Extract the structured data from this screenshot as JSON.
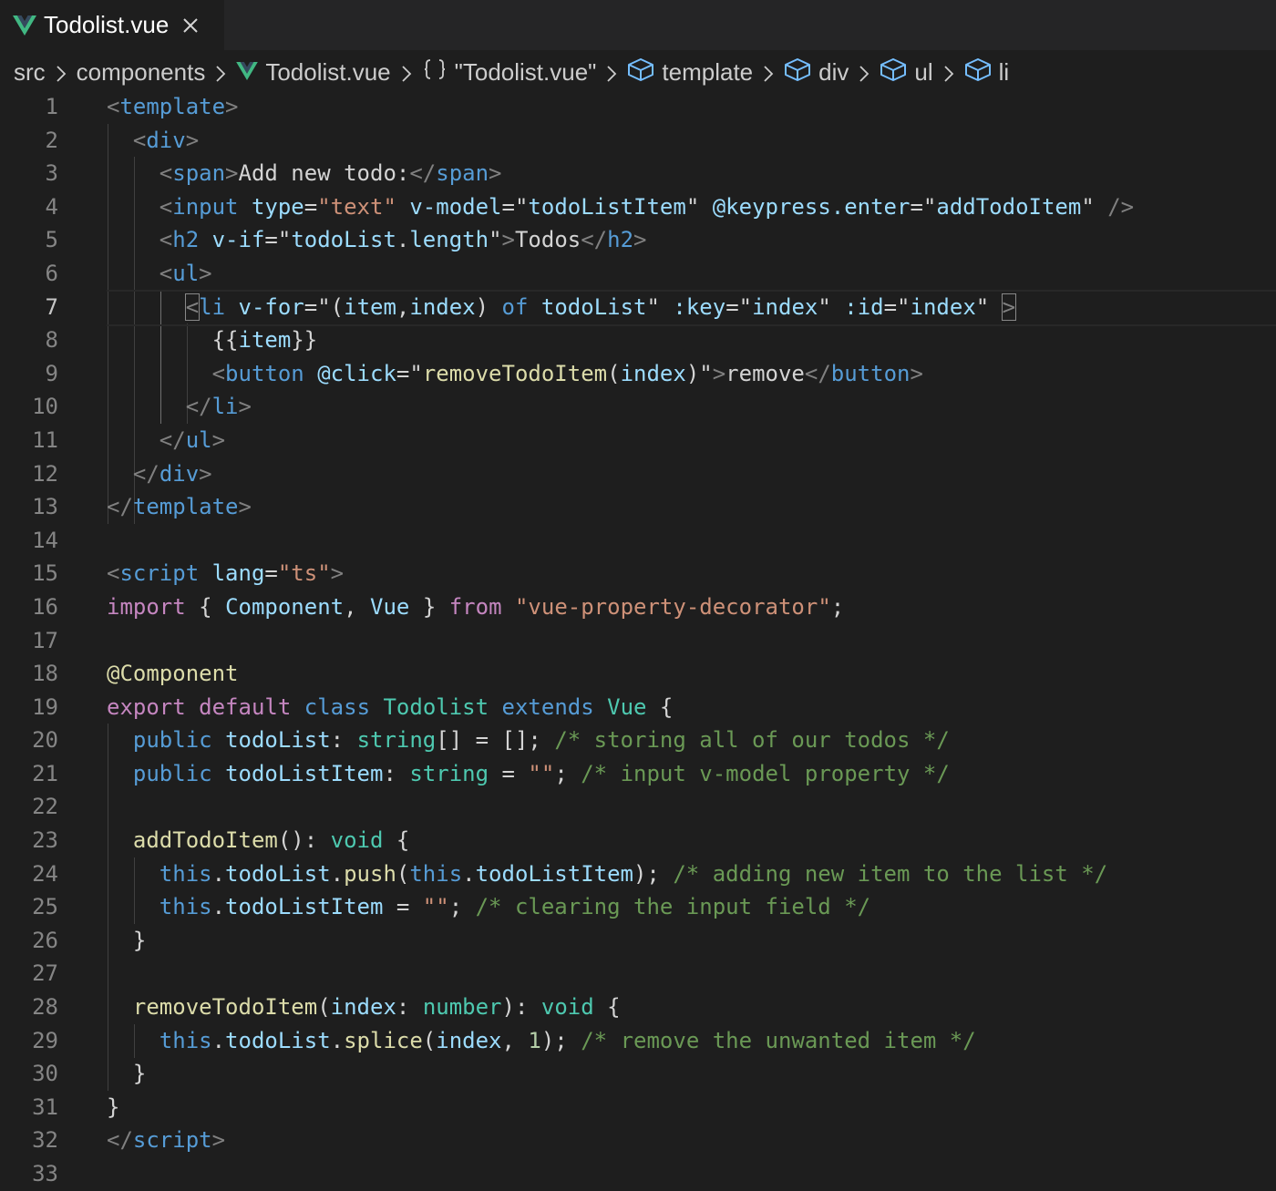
{
  "tab": {
    "title": "Todolist.vue",
    "icon": "vue-logo-icon",
    "close_icon": "close-icon"
  },
  "breadcrumb": [
    "src",
    "components",
    "Todolist.vue",
    "\"Todolist.vue\"",
    "template",
    "div",
    "ul",
    "li"
  ],
  "breadcrumb_icons": {
    "file": "vue-logo-icon",
    "root": "braces-icon",
    "element": "symbol-cube-icon"
  },
  "editor": {
    "current_line": 7,
    "line_numbers": [
      "1",
      "2",
      "3",
      "4",
      "5",
      "6",
      "7",
      "8",
      "9",
      "10",
      "11",
      "12",
      "13",
      "14",
      "15",
      "16",
      "17",
      "18",
      "19",
      "20",
      "21",
      "22",
      "23",
      "24",
      "25",
      "26",
      "27",
      "28",
      "29",
      "30",
      "31",
      "32",
      "33"
    ],
    "lines": [
      [
        [
          "tg",
          "<"
        ],
        [
          "tn",
          "template"
        ],
        [
          "tg",
          ">"
        ]
      ],
      [
        [
          "txt",
          "  "
        ],
        [
          "tg",
          "<"
        ],
        [
          "tn",
          "div"
        ],
        [
          "tg",
          ">"
        ]
      ],
      [
        [
          "txt",
          "    "
        ],
        [
          "tg",
          "<"
        ],
        [
          "tn",
          "span"
        ],
        [
          "tg",
          ">"
        ],
        [
          "txt",
          "Add new todo:"
        ],
        [
          "tg",
          "</"
        ],
        [
          "tn",
          "span"
        ],
        [
          "tg",
          ">"
        ]
      ],
      [
        [
          "txt",
          "    "
        ],
        [
          "tg",
          "<"
        ],
        [
          "tn",
          "input"
        ],
        [
          "txt",
          " "
        ],
        [
          "at",
          "type"
        ],
        [
          "txt",
          "="
        ],
        [
          "str",
          "\"text\""
        ],
        [
          "txt",
          " "
        ],
        [
          "at",
          "v-model"
        ],
        [
          "txt",
          "=\""
        ],
        [
          "var",
          "todoListItem"
        ],
        [
          "txt",
          "\" "
        ],
        [
          "at",
          "@keypress.enter"
        ],
        [
          "txt",
          "=\""
        ],
        [
          "var",
          "addTodoItem"
        ],
        [
          "txt",
          "\" "
        ],
        [
          "tg",
          "/>"
        ]
      ],
      [
        [
          "txt",
          "    "
        ],
        [
          "tg",
          "<"
        ],
        [
          "tn",
          "h2"
        ],
        [
          "txt",
          " "
        ],
        [
          "at",
          "v-if"
        ],
        [
          "txt",
          "=\""
        ],
        [
          "var",
          "todoList"
        ],
        [
          "txt",
          "."
        ],
        [
          "var",
          "length"
        ],
        [
          "txt",
          "\""
        ],
        [
          "tg",
          ">"
        ],
        [
          "txt",
          "Todos"
        ],
        [
          "tg",
          "</"
        ],
        [
          "tn",
          "h2"
        ],
        [
          "tg",
          ">"
        ]
      ],
      [
        [
          "txt",
          "    "
        ],
        [
          "tg",
          "<"
        ],
        [
          "tn",
          "ul"
        ],
        [
          "tg",
          ">"
        ]
      ],
      [
        [
          "txt",
          "      "
        ],
        [
          "tg",
          "<",
          "box"
        ],
        [
          "tn",
          "li"
        ],
        [
          "txt",
          " "
        ],
        [
          "at",
          "v-for"
        ],
        [
          "txt",
          "=\"("
        ],
        [
          "var",
          "item"
        ],
        [
          "txt",
          ","
        ],
        [
          "var",
          "index"
        ],
        [
          "txt",
          ") "
        ],
        [
          "kw2",
          "of"
        ],
        [
          "txt",
          " "
        ],
        [
          "var",
          "todoList"
        ],
        [
          "txt",
          "\" "
        ],
        [
          "at",
          ":key"
        ],
        [
          "txt",
          "=\""
        ],
        [
          "var",
          "index"
        ],
        [
          "txt",
          "\" "
        ],
        [
          "at",
          ":id"
        ],
        [
          "txt",
          "=\""
        ],
        [
          "var",
          "index"
        ],
        [
          "txt",
          "\" "
        ],
        [
          "tg",
          ">",
          "box"
        ]
      ],
      [
        [
          "txt",
          "        {{"
        ],
        [
          "var",
          "item"
        ],
        [
          "txt",
          "}}"
        ]
      ],
      [
        [
          "txt",
          "        "
        ],
        [
          "tg",
          "<"
        ],
        [
          "tn",
          "button"
        ],
        [
          "txt",
          " "
        ],
        [
          "at",
          "@click"
        ],
        [
          "txt",
          "=\""
        ],
        [
          "fn",
          "removeTodoItem"
        ],
        [
          "txt",
          "("
        ],
        [
          "var",
          "index"
        ],
        [
          "txt",
          ")\""
        ],
        [
          "tg",
          ">"
        ],
        [
          "txt",
          "remove"
        ],
        [
          "tg",
          "</"
        ],
        [
          "tn",
          "button"
        ],
        [
          "tg",
          ">"
        ]
      ],
      [
        [
          "txt",
          "      "
        ],
        [
          "tg",
          "</"
        ],
        [
          "tn",
          "li"
        ],
        [
          "tg",
          ">"
        ]
      ],
      [
        [
          "txt",
          "    "
        ],
        [
          "tg",
          "</"
        ],
        [
          "tn",
          "ul"
        ],
        [
          "tg",
          ">"
        ]
      ],
      [
        [
          "txt",
          "  "
        ],
        [
          "tg",
          "</"
        ],
        [
          "tn",
          "div"
        ],
        [
          "tg",
          ">"
        ]
      ],
      [
        [
          "tg",
          "</"
        ],
        [
          "tn",
          "template"
        ],
        [
          "tg",
          ">"
        ]
      ],
      [],
      [
        [
          "tg",
          "<"
        ],
        [
          "tn",
          "script"
        ],
        [
          "txt",
          " "
        ],
        [
          "at",
          "lang"
        ],
        [
          "txt",
          "="
        ],
        [
          "str",
          "\"ts\""
        ],
        [
          "tg",
          ">"
        ]
      ],
      [
        [
          "kw",
          "import"
        ],
        [
          "txt",
          " { "
        ],
        [
          "var",
          "Component"
        ],
        [
          "txt",
          ", "
        ],
        [
          "var",
          "Vue"
        ],
        [
          "txt",
          " } "
        ],
        [
          "kw",
          "from"
        ],
        [
          "txt",
          " "
        ],
        [
          "str",
          "\"vue-property-decorator\""
        ],
        [
          "txt",
          ";"
        ]
      ],
      [],
      [
        [
          "dec",
          "@"
        ],
        [
          "fn",
          "Component"
        ]
      ],
      [
        [
          "kw",
          "export"
        ],
        [
          "txt",
          " "
        ],
        [
          "kw",
          "default"
        ],
        [
          "txt",
          " "
        ],
        [
          "kw2",
          "class"
        ],
        [
          "txt",
          " "
        ],
        [
          "cls",
          "Todolist"
        ],
        [
          "txt",
          " "
        ],
        [
          "kw2",
          "extends"
        ],
        [
          "txt",
          " "
        ],
        [
          "cls",
          "Vue"
        ],
        [
          "txt",
          " {"
        ]
      ],
      [
        [
          "txt",
          "  "
        ],
        [
          "kw2",
          "public"
        ],
        [
          "txt",
          " "
        ],
        [
          "var",
          "todoList"
        ],
        [
          "txt",
          ": "
        ],
        [
          "cls",
          "string"
        ],
        [
          "txt",
          "[] = []; "
        ],
        [
          "cm",
          "/* storing all of our todos */"
        ]
      ],
      [
        [
          "txt",
          "  "
        ],
        [
          "kw2",
          "public"
        ],
        [
          "txt",
          " "
        ],
        [
          "var",
          "todoListItem"
        ],
        [
          "txt",
          ": "
        ],
        [
          "cls",
          "string"
        ],
        [
          "txt",
          " = "
        ],
        [
          "str",
          "\"\""
        ],
        [
          "txt",
          "; "
        ],
        [
          "cm",
          "/* input v-model property */"
        ]
      ],
      [],
      [
        [
          "txt",
          "  "
        ],
        [
          "fn",
          "addTodoItem"
        ],
        [
          "txt",
          "(): "
        ],
        [
          "cls",
          "void"
        ],
        [
          "txt",
          " {"
        ]
      ],
      [
        [
          "txt",
          "    "
        ],
        [
          "kw2",
          "this"
        ],
        [
          "txt",
          "."
        ],
        [
          "var",
          "todoList"
        ],
        [
          "txt",
          "."
        ],
        [
          "fn",
          "push"
        ],
        [
          "txt",
          "("
        ],
        [
          "kw2",
          "this"
        ],
        [
          "txt",
          "."
        ],
        [
          "var",
          "todoListItem"
        ],
        [
          "txt",
          "); "
        ],
        [
          "cm",
          "/* adding new item to the list */"
        ]
      ],
      [
        [
          "txt",
          "    "
        ],
        [
          "kw2",
          "this"
        ],
        [
          "txt",
          "."
        ],
        [
          "var",
          "todoListItem"
        ],
        [
          "txt",
          " = "
        ],
        [
          "str",
          "\"\""
        ],
        [
          "txt",
          "; "
        ],
        [
          "cm",
          "/* clearing the input field */"
        ]
      ],
      [
        [
          "txt",
          "  }"
        ]
      ],
      [],
      [
        [
          "txt",
          "  "
        ],
        [
          "fn",
          "removeTodoItem"
        ],
        [
          "txt",
          "("
        ],
        [
          "var",
          "index"
        ],
        [
          "txt",
          ": "
        ],
        [
          "cls",
          "number"
        ],
        [
          "txt",
          "): "
        ],
        [
          "cls",
          "void"
        ],
        [
          "txt",
          " {"
        ]
      ],
      [
        [
          "txt",
          "    "
        ],
        [
          "kw2",
          "this"
        ],
        [
          "txt",
          "."
        ],
        [
          "var",
          "todoList"
        ],
        [
          "txt",
          "."
        ],
        [
          "fn",
          "splice"
        ],
        [
          "txt",
          "("
        ],
        [
          "var",
          "index"
        ],
        [
          "txt",
          ", "
        ],
        [
          "num",
          "1"
        ],
        [
          "txt",
          "); "
        ],
        [
          "cm",
          "/* remove the unwanted item */"
        ]
      ],
      [
        [
          "txt",
          "  }"
        ]
      ],
      [
        [
          "txt",
          "}"
        ]
      ],
      [
        [
          "tg",
          "</"
        ],
        [
          "tn",
          "script"
        ],
        [
          "tg",
          ">"
        ]
      ],
      []
    ]
  }
}
